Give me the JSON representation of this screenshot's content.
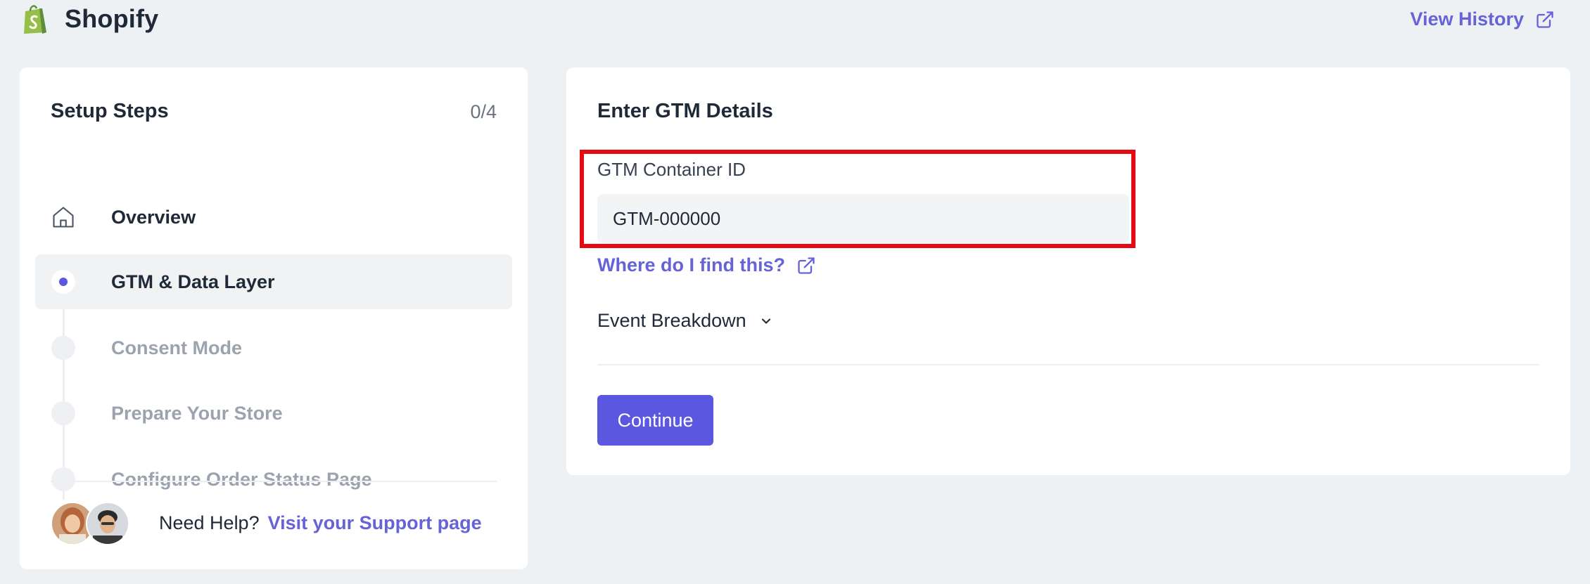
{
  "header": {
    "brand_name": "Shopify",
    "view_history_label": "View History"
  },
  "setup": {
    "title": "Setup Steps",
    "progress": "0/4",
    "steps": [
      {
        "label": "Overview",
        "state": "done",
        "icon": "home-icon"
      },
      {
        "label": "GTM & Data Layer",
        "state": "active",
        "icon": "active-dot-icon"
      },
      {
        "label": "Consent Mode",
        "state": "pending",
        "icon": "pending-dot-icon"
      },
      {
        "label": "Prepare Your Store",
        "state": "pending",
        "icon": "pending-dot-icon"
      },
      {
        "label": "Configure Order Status Page",
        "state": "pending",
        "icon": "pending-dot-icon"
      }
    ],
    "help": {
      "text": "Need Help?",
      "link": "Visit your Support page"
    }
  },
  "gtm": {
    "title": "Enter GTM Details",
    "field_label": "GTM Container ID",
    "field_value": "GTM-000000",
    "find_link": "Where do I find this?",
    "event_breakdown": "Event Breakdown",
    "continue_label": "Continue"
  },
  "colors": {
    "accent": "#5b57e0",
    "link": "#6663d6",
    "highlight": "#e50914",
    "background": "#eef1f4",
    "brand_green": "#95bf47"
  }
}
